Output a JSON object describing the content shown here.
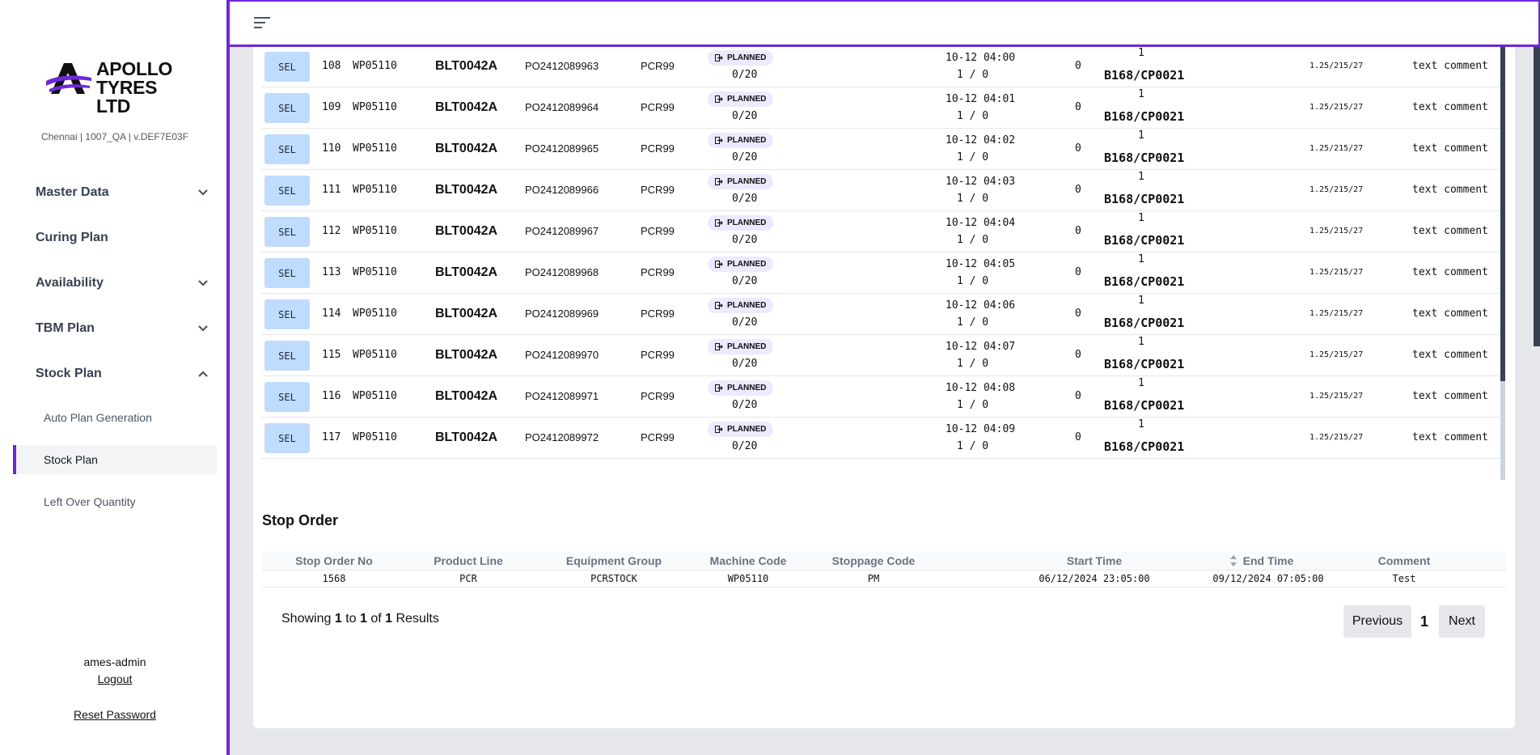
{
  "brand": {
    "name_line1": "APOLLO",
    "name_line2": "TYRES LTD",
    "accent": "#6d28d9"
  },
  "env": "Chennai | 1007_QA | v.DEF7E03F",
  "nav": {
    "master_data": "Master Data",
    "curing_plan": "Curing Plan",
    "availability": "Availability",
    "tbm_plan": "TBM Plan",
    "stock_plan": "Stock Plan",
    "sub": {
      "auto_plan": "Auto Plan Generation",
      "stock_plan": "Stock Plan",
      "left_over": "Left Over Quantity"
    }
  },
  "user": {
    "name": "ames-admin",
    "logout": "Logout",
    "reset": "Reset Password"
  },
  "rows": [
    {
      "sel": "SEL",
      "id": "108",
      "wp": "WP05110",
      "blt": "BLT0042A",
      "po": "PO2412089963",
      "pcr": "PCR99",
      "status": "PLANNED",
      "qty": "0/20",
      "time": "10-12 04:00",
      "ratio": "1 / 0",
      "zero": "0",
      "one": "1",
      "cp": "B168/CP0021",
      "size": "1.25/215/27",
      "comment": "text comment"
    },
    {
      "sel": "SEL",
      "id": "109",
      "wp": "WP05110",
      "blt": "BLT0042A",
      "po": "PO2412089964",
      "pcr": "PCR99",
      "status": "PLANNED",
      "qty": "0/20",
      "time": "10-12 04:01",
      "ratio": "1 / 0",
      "zero": "0",
      "one": "1",
      "cp": "B168/CP0021",
      "size": "1.25/215/27",
      "comment": "text comment"
    },
    {
      "sel": "SEL",
      "id": "110",
      "wp": "WP05110",
      "blt": "BLT0042A",
      "po": "PO2412089965",
      "pcr": "PCR99",
      "status": "PLANNED",
      "qty": "0/20",
      "time": "10-12 04:02",
      "ratio": "1 / 0",
      "zero": "0",
      "one": "1",
      "cp": "B168/CP0021",
      "size": "1.25/215/27",
      "comment": "text comment"
    },
    {
      "sel": "SEL",
      "id": "111",
      "wp": "WP05110",
      "blt": "BLT0042A",
      "po": "PO2412089966",
      "pcr": "PCR99",
      "status": "PLANNED",
      "qty": "0/20",
      "time": "10-12 04:03",
      "ratio": "1 / 0",
      "zero": "0",
      "one": "1",
      "cp": "B168/CP0021",
      "size": "1.25/215/27",
      "comment": "text comment"
    },
    {
      "sel": "SEL",
      "id": "112",
      "wp": "WP05110",
      "blt": "BLT0042A",
      "po": "PO2412089967",
      "pcr": "PCR99",
      "status": "PLANNED",
      "qty": "0/20",
      "time": "10-12 04:04",
      "ratio": "1 / 0",
      "zero": "0",
      "one": "1",
      "cp": "B168/CP0021",
      "size": "1.25/215/27",
      "comment": "text comment"
    },
    {
      "sel": "SEL",
      "id": "113",
      "wp": "WP05110",
      "blt": "BLT0042A",
      "po": "PO2412089968",
      "pcr": "PCR99",
      "status": "PLANNED",
      "qty": "0/20",
      "time": "10-12 04:05",
      "ratio": "1 / 0",
      "zero": "0",
      "one": "1",
      "cp": "B168/CP0021",
      "size": "1.25/215/27",
      "comment": "text comment"
    },
    {
      "sel": "SEL",
      "id": "114",
      "wp": "WP05110",
      "blt": "BLT0042A",
      "po": "PO2412089969",
      "pcr": "PCR99",
      "status": "PLANNED",
      "qty": "0/20",
      "time": "10-12 04:06",
      "ratio": "1 / 0",
      "zero": "0",
      "one": "1",
      "cp": "B168/CP0021",
      "size": "1.25/215/27",
      "comment": "text comment"
    },
    {
      "sel": "SEL",
      "id": "115",
      "wp": "WP05110",
      "blt": "BLT0042A",
      "po": "PO2412089970",
      "pcr": "PCR99",
      "status": "PLANNED",
      "qty": "0/20",
      "time": "10-12 04:07",
      "ratio": "1 / 0",
      "zero": "0",
      "one": "1",
      "cp": "B168/CP0021",
      "size": "1.25/215/27",
      "comment": "text comment"
    },
    {
      "sel": "SEL",
      "id": "116",
      "wp": "WP05110",
      "blt": "BLT0042A",
      "po": "PO2412089971",
      "pcr": "PCR99",
      "status": "PLANNED",
      "qty": "0/20",
      "time": "10-12 04:08",
      "ratio": "1 / 0",
      "zero": "0",
      "one": "1",
      "cp": "B168/CP0021",
      "size": "1.25/215/27",
      "comment": "text comment"
    },
    {
      "sel": "SEL",
      "id": "117",
      "wp": "WP05110",
      "blt": "BLT0042A",
      "po": "PO2412089972",
      "pcr": "PCR99",
      "status": "PLANNED",
      "qty": "0/20",
      "time": "10-12 04:09",
      "ratio": "1 / 0",
      "zero": "0",
      "one": "1",
      "cp": "B168/CP0021",
      "size": "1.25/215/27",
      "comment": "text comment"
    }
  ],
  "stop_order": {
    "title": "Stop Order",
    "headers": [
      "Stop Order No",
      "Product Line",
      "Equipment Group",
      "Machine Code",
      "Stoppage Code",
      "Start Time",
      "End Time",
      "Comment"
    ],
    "rows": [
      [
        "1568",
        "PCR",
        "PCRSTOCK",
        "WP05110",
        "PM",
        "06/12/2024 23:05:00",
        "09/12/2024 07:05:00",
        "Test"
      ]
    ],
    "showing": {
      "prefix": "Showing",
      "from": "1",
      "to_word": "to",
      "to": "1",
      "of_word": "of",
      "total": "1",
      "suffix": "Results"
    },
    "pager": {
      "previous": "Previous",
      "page": "1",
      "next": "Next"
    }
  }
}
